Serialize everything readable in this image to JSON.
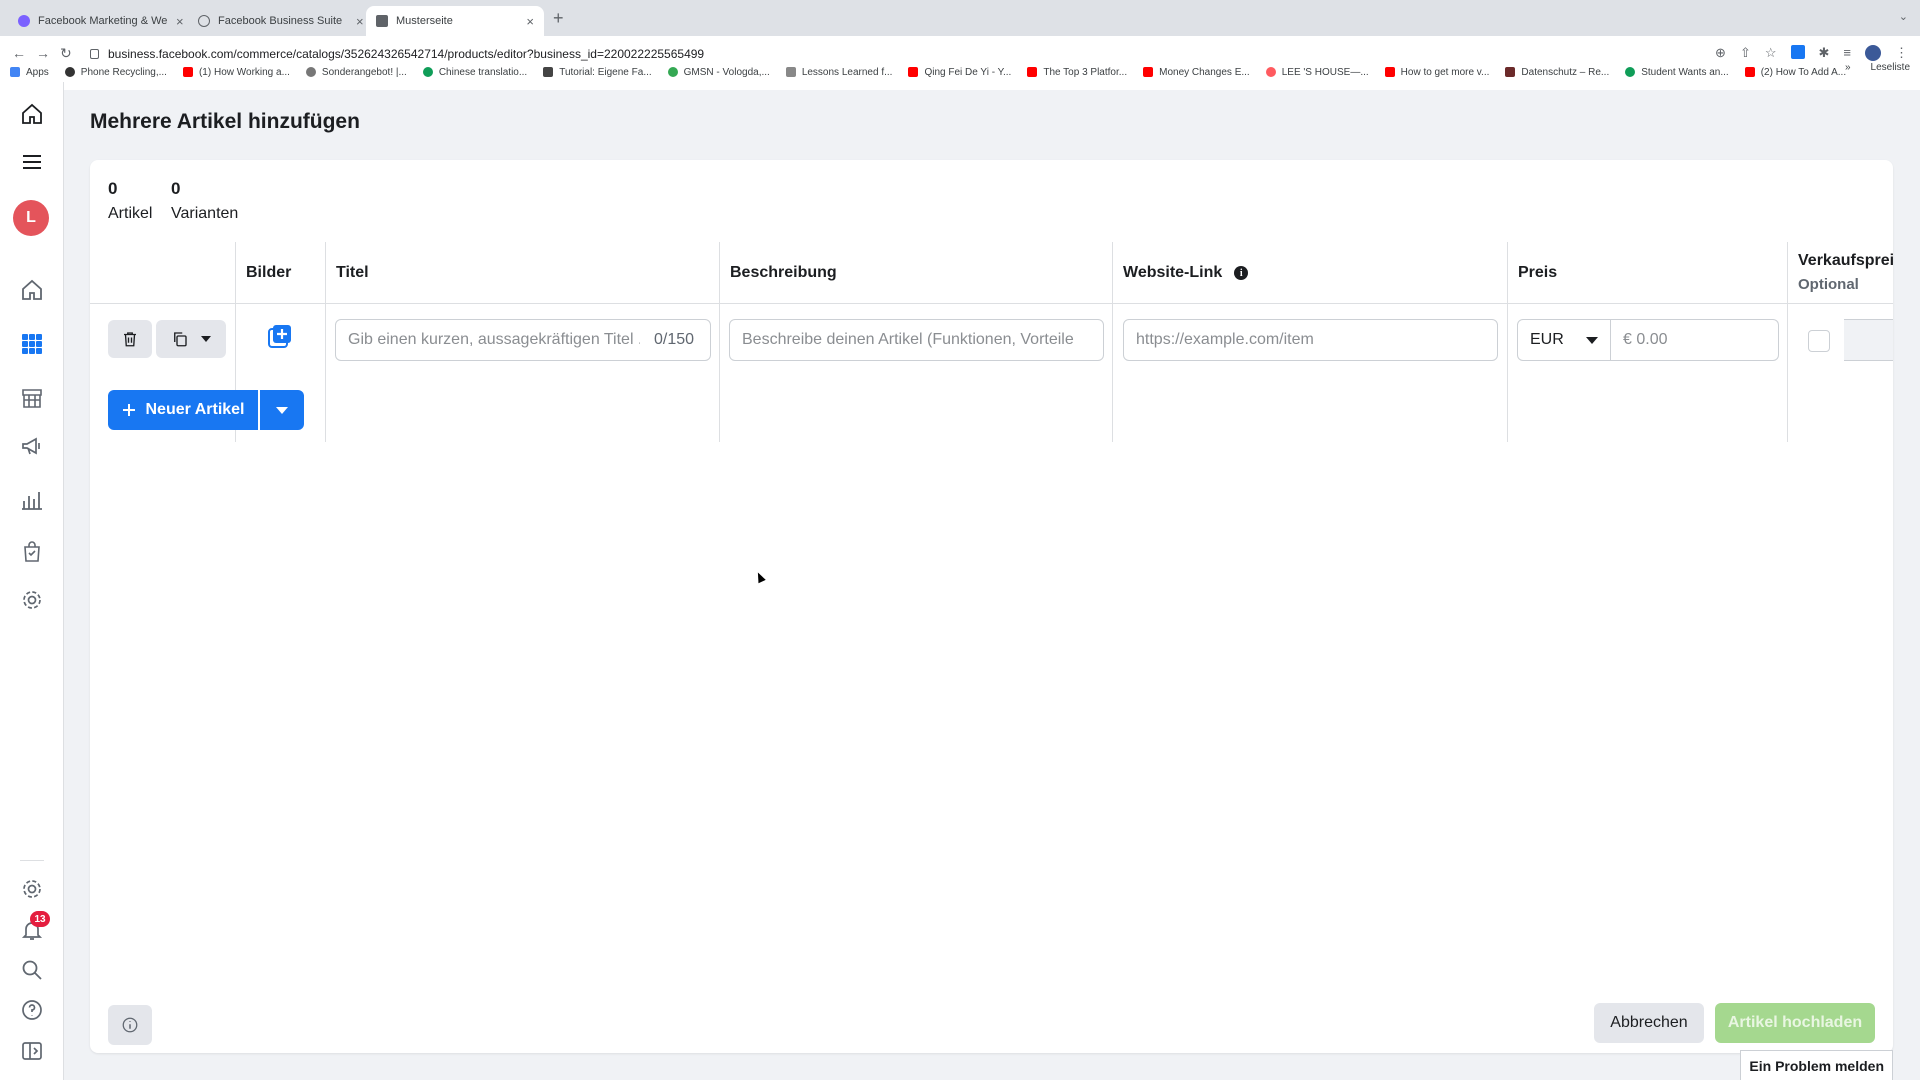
{
  "browser": {
    "tabs": [
      {
        "title": "Facebook Marketing & Werbe...",
        "active": false
      },
      {
        "title": "Facebook Business Suite",
        "active": false
      },
      {
        "title": "Musterseite",
        "active": true
      }
    ],
    "url": "business.facebook.com/commerce/catalogs/352624326542714/products/editor?business_id=220022225565499",
    "bookmarks": [
      "Apps",
      "Phone Recycling,...",
      "(1) How Working a...",
      "Sonderangebot! |...",
      "Chinese translatio...",
      "Tutorial: Eigene Fa...",
      "GMSN - Vologda,...",
      "Lessons Learned f...",
      "Qing Fei De Yi - Y...",
      "The Top 3 Platfor...",
      "Money Changes E...",
      "LEE 'S HOUSE—...",
      "How to get more v...",
      "Datenschutz – Re...",
      "Student Wants an...",
      "(2) How To Add A..."
    ],
    "bookmarks_more": "»",
    "reading_list": "Leseliste"
  },
  "rail": {
    "avatar_letter": "L",
    "notification_count": "13"
  },
  "page": {
    "title": "Mehrere Artikel hinzufügen",
    "stats": [
      {
        "value": "0",
        "label": "Artikel"
      },
      {
        "value": "0",
        "label": "Varianten"
      }
    ],
    "columns": {
      "images": "Bilder",
      "title": "Titel",
      "description": "Beschreibung",
      "website": "Website-Link",
      "price": "Preis",
      "sale_price": "Verkaufspreis",
      "sale_price_sub": "Optional"
    },
    "row": {
      "title_placeholder": "Gib einen kurzen, aussagekräftigen Titel ...",
      "title_count": "0/150",
      "description_placeholder": "Beschreibe deinen Artikel (Funktionen, Vorteile",
      "website_placeholder": "https://example.com/item",
      "currency": "EUR",
      "price_placeholder": "€ 0.00"
    },
    "new_item_label": "Neuer Artikel",
    "cancel_label": "Abbrechen",
    "upload_label": "Artikel hochladen",
    "report_label": "Ein Problem melden"
  }
}
